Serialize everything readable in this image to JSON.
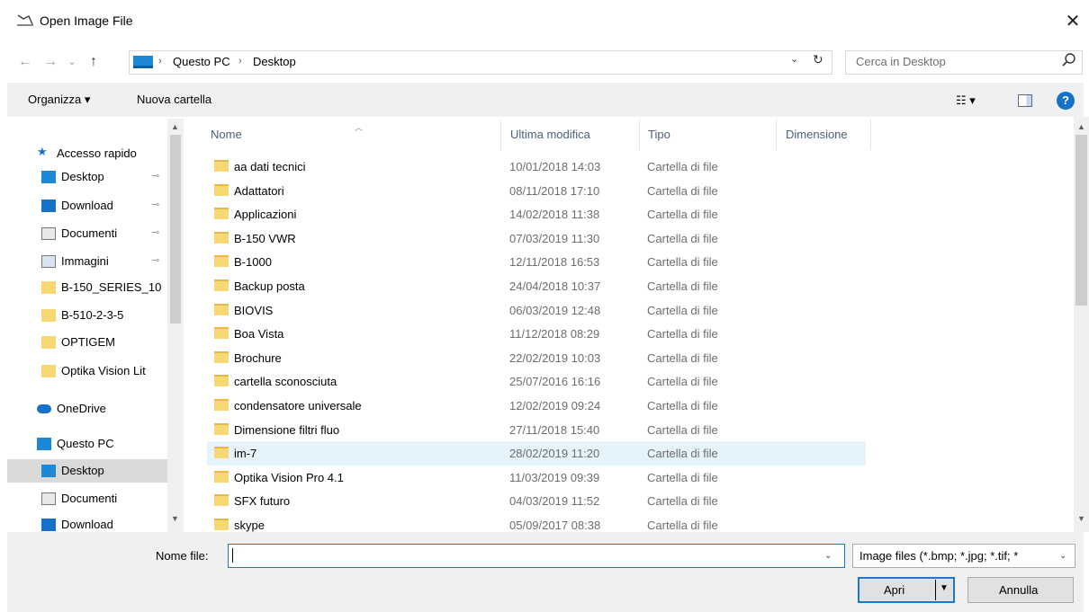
{
  "window": {
    "title": "Open Image File",
    "close_glyph": "✕"
  },
  "nav": {
    "back_glyph": "←",
    "forward_glyph": "→",
    "recent_glyph": "⌄",
    "up_glyph": "↑",
    "breadcrumb": [
      "Questo PC",
      "Desktop"
    ],
    "breadcrumb_sep": "›",
    "dropdown_glyph": "⌄",
    "refresh_glyph": "↻",
    "search_placeholder": "Cerca in Desktop"
  },
  "toolbar": {
    "organize": "Organizza ▾",
    "new_folder": "Nuova cartella",
    "view_glyph": "☷ ▾",
    "help_glyph": "?"
  },
  "sidebar": {
    "items": [
      {
        "label": "Accesso rapido",
        "icon": "star-icon",
        "pinned": false
      },
      {
        "label": "Desktop",
        "icon": "desktop-icon",
        "pinned": true
      },
      {
        "label": "Download",
        "icon": "download-icon",
        "pinned": true
      },
      {
        "label": "Documenti",
        "icon": "document-icon",
        "pinned": true
      },
      {
        "label": "Immagini",
        "icon": "image-icon",
        "pinned": true
      },
      {
        "label": "B-150_SERIES_10",
        "icon": "folder-icon",
        "pinned": false
      },
      {
        "label": "B-510-2-3-5",
        "icon": "folder-icon",
        "pinned": false
      },
      {
        "label": "OPTIGEM",
        "icon": "folder-icon",
        "pinned": false
      },
      {
        "label": "Optika Vision Lit",
        "icon": "folder-icon",
        "pinned": false
      },
      {
        "label": "OneDrive",
        "icon": "cloud-icon",
        "pinned": false
      },
      {
        "label": "Questo PC",
        "icon": "pc-icon",
        "pinned": false
      },
      {
        "label": "Desktop",
        "icon": "desktop-icon",
        "pinned": false,
        "selected": true
      },
      {
        "label": "Documenti",
        "icon": "document-icon",
        "pinned": false
      },
      {
        "label": "Download",
        "icon": "download-icon",
        "pinned": false
      }
    ],
    "pin_glyph": "📌"
  },
  "columns": {
    "name": "Nome",
    "modified": "Ultima modifica",
    "type": "Tipo",
    "size": "Dimensione"
  },
  "files": [
    {
      "name": "aa dati tecnici",
      "date": "10/01/2018 14:03",
      "type": "Cartella di file"
    },
    {
      "name": "Adattatori",
      "date": "08/11/2018 17:10",
      "type": "Cartella di file"
    },
    {
      "name": "Applicazioni",
      "date": "14/02/2018 11:38",
      "type": "Cartella di file"
    },
    {
      "name": "B-150 VWR",
      "date": "07/03/2019 11:30",
      "type": "Cartella di file"
    },
    {
      "name": "B-1000",
      "date": "12/11/2018 16:53",
      "type": "Cartella di file"
    },
    {
      "name": "Backup posta",
      "date": "24/04/2018 10:37",
      "type": "Cartella di file"
    },
    {
      "name": "BIOVIS",
      "date": "06/03/2019 12:48",
      "type": "Cartella di file"
    },
    {
      "name": "Boa Vista",
      "date": "11/12/2018 08:29",
      "type": "Cartella di file"
    },
    {
      "name": "Brochure",
      "date": "22/02/2019 10:03",
      "type": "Cartella di file"
    },
    {
      "name": "cartella sconosciuta",
      "date": "25/07/2016 16:16",
      "type": "Cartella di file"
    },
    {
      "name": "condensatore universale",
      "date": "12/02/2019 09:24",
      "type": "Cartella di file"
    },
    {
      "name": "Dimensione filtri fluo",
      "date": "27/11/2018 15:40",
      "type": "Cartella di file"
    },
    {
      "name": "im-7",
      "date": "28/02/2019 11:20",
      "type": "Cartella di file",
      "hover": true
    },
    {
      "name": "Optika Vision Pro 4.1",
      "date": "11/03/2019 09:39",
      "type": "Cartella di file"
    },
    {
      "name": "SFX futuro",
      "date": "04/03/2019 11:52",
      "type": "Cartella di file"
    },
    {
      "name": "skype",
      "date": "05/09/2017 08:38",
      "type": "Cartella di file"
    }
  ],
  "bottom": {
    "filename_label": "Nome file:",
    "filename_value": "",
    "filter": "Image files (*.bmp; *.jpg; *.tif; *",
    "open": "Apri",
    "cancel": "Annulla"
  },
  "colors": {
    "accent": "#1b78d1",
    "folder": "#f8d775",
    "hover_row": "#e5f3fb",
    "selected_side": "#d9d9d9"
  }
}
